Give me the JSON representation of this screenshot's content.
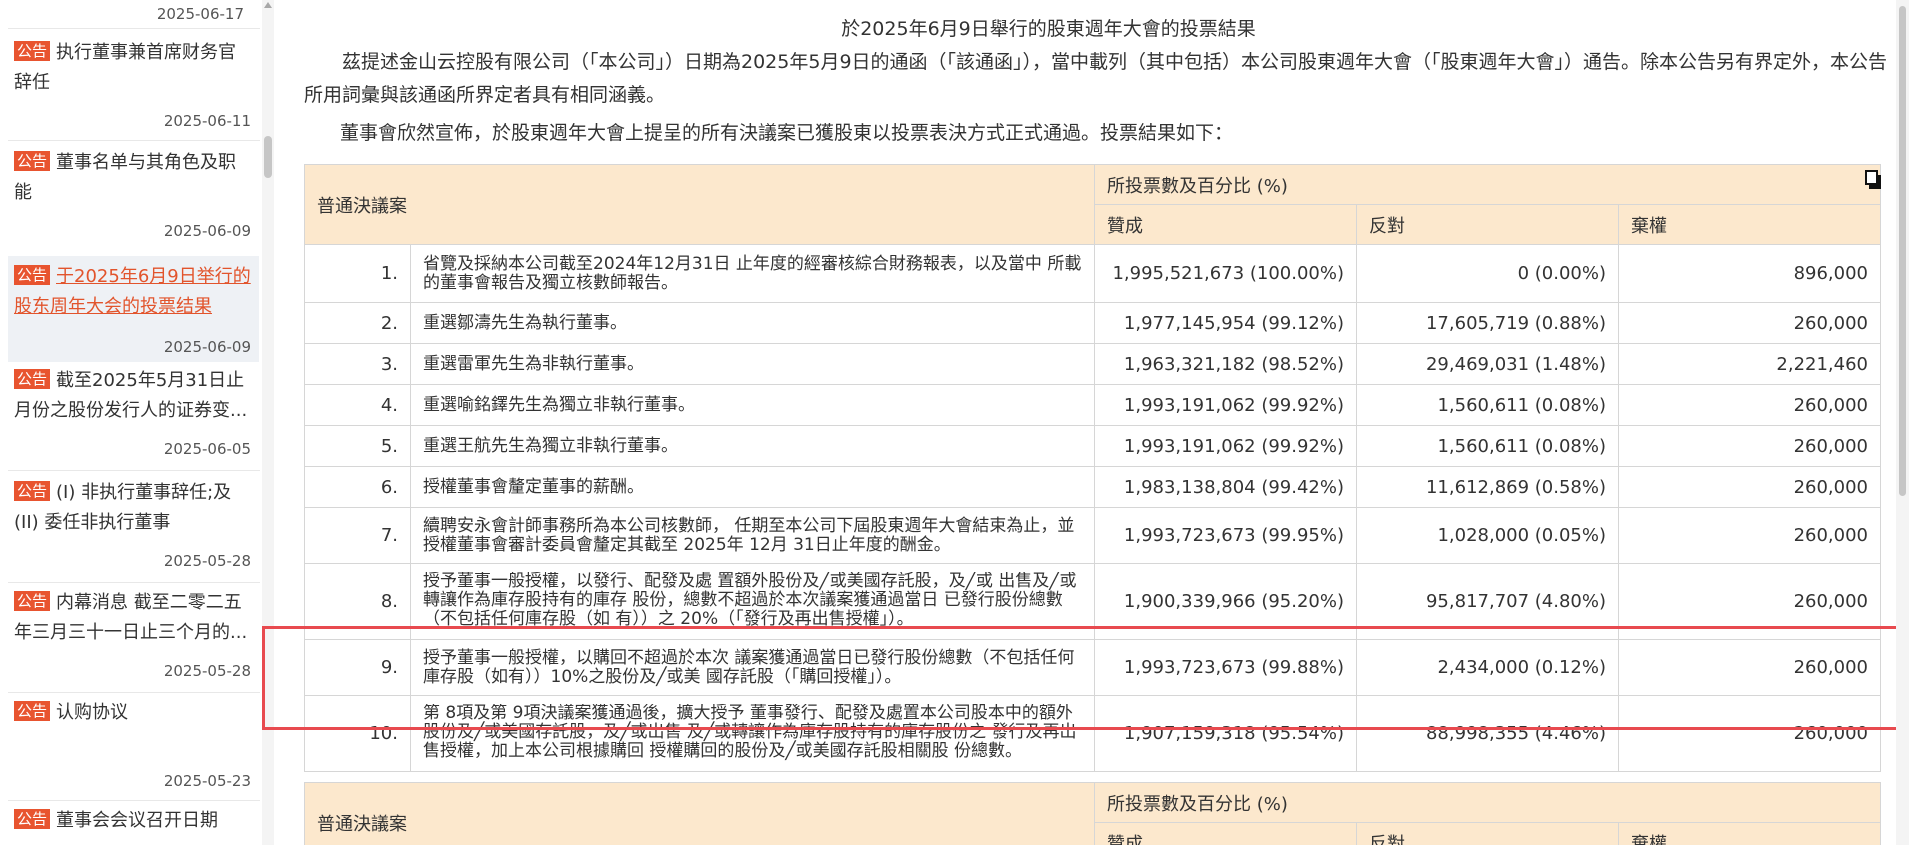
{
  "sidebar": {
    "top_date": "2025-06-17",
    "badge": "公告",
    "items": [
      {
        "title": "执行董事兼首席财务官辞任",
        "date": "2025-06-11"
      },
      {
        "title": "董事名单与其角色及职能",
        "date": "2025-06-09"
      },
      {
        "title": "于2025年6月9日举行的股东周年大会的投票结果",
        "date": "2025-06-09",
        "active": true
      },
      {
        "title": "截至2025年5月31日止月份之股份发行人的证券变...",
        "date": "2025-06-05"
      },
      {
        "title": "(I) 非执行董事辞任;及(II) 委任非执行董事",
        "date": "2025-05-28"
      },
      {
        "title": "内幕消息 截至二零二五年三月三十一日止三个月的...",
        "date": "2025-05-28"
      },
      {
        "title": "认购协议",
        "date": "2025-05-23"
      },
      {
        "title": "董事会会议召开日期",
        "date": ""
      }
    ]
  },
  "main": {
    "subtitle": "於2025年6月9日舉行的股東週年大會的投票結果",
    "para1": "茲提述金山云控股有限公司（「本公司」）日期為2025年5月9日的通函（「該通函」），當中載列（其中包括）本公司股東週年大會（「股東週年大會」）通告。除本公告另有界定外，本公告所用詞彙與該通函所界定者具有相同涵義。",
    "para2": "董事會欣然宣佈，於股東週年大會上提呈的所有決議案已獲股東以投票表決方式正式通過。投票結果如下：",
    "table": {
      "header_resolution": "普通決議案",
      "header_votes": "所投票數及百分比 (%)",
      "col_for": "贊成",
      "col_against": "反對",
      "col_abstain": "棄權",
      "rows": [
        {
          "no": "1.",
          "desc": "省覽及採納本公司截至2024年12月31日 止年度的經審核綜合財務報表，以及當中 所載的董事會報告及獨立核數師報告。",
          "for": "1,995,521,673 (100.00%)",
          "against": "0 (0.00%)",
          "abstain": "896,000"
        },
        {
          "no": "2.",
          "desc": "重選鄒濤先生為執行董事。",
          "for": "1,977,145,954 (99.12%)",
          "against": "17,605,719 (0.88%)",
          "abstain": "260,000"
        },
        {
          "no": "3.",
          "desc": "重選雷軍先生為非執行董事。",
          "for": "1,963,321,182 (98.52%)",
          "against": "29,469,031 (1.48%)",
          "abstain": "2,221,460"
        },
        {
          "no": "4.",
          "desc": "重選喻銘鐸先生為獨立非執行董事。",
          "for": "1,993,191,062 (99.92%)",
          "against": "1,560,611 (0.08%)",
          "abstain": "260,000"
        },
        {
          "no": "5.",
          "desc": "重選王航先生為獨立非執行董事。",
          "for": "1,993,191,062 (99.92%)",
          "against": "1,560,611 (0.08%)",
          "abstain": "260,000"
        },
        {
          "no": "6.",
          "desc": "授權董事會釐定董事的薪酬。",
          "for": "1,983,138,804 (99.42%)",
          "against": "11,612,869 (0.58%)",
          "abstain": "260,000"
        },
        {
          "no": "7.",
          "desc": "續聘安永會計師事務所為本公司核數師， 任期至本公司下屆股東週年大會結束為止，並授權董事會審計委員會釐定其截至 2025年 12月 31日止年度的酬金。",
          "for": "1,993,723,673 (99.95%)",
          "against": "1,028,000 (0.05%)",
          "abstain": "260,000"
        },
        {
          "no": "8.",
          "desc": "授予董事一般授權，以發行、配發及處 置額外股份及╱或美國存託股，及╱或 出售及╱或轉讓作為庫存股持有的庫存 股份，總數不超過於本次議案獲通過當日 已發行股份總數（不包括任何庫存股（如 有））之 20%（「發行及再出售授權」）。",
          "for": "1,900,339,966 (95.20%)",
          "against": "95,817,707 (4.80%)",
          "abstain": "260,000"
        },
        {
          "no": "9.",
          "desc": "授予董事一般授權，以購回不超過於本次 議案獲通過當日已發行股份總數（不包括任何庫存股（如有））10%之股份及╱或美 國存託股（「購回授權」）。",
          "for": "1,993,723,673 (99.88%)",
          "against": "2,434,000 (0.12%)",
          "abstain": "260,000"
        },
        {
          "no": "10.",
          "desc": "第 8項及第 9項決議案獲通過後，擴大授予 董事發行、配發及處置本公司股本中的額外股份及╱或美國存託股，及╱或出售 及╱或轉讓作為庫存股持有的庫存股份之 發行及再出售授權，加上本公司根據購回 授權購回的股份及╱或美國存託股相關股 份總數。",
          "for": "1,907,159,318 (95.54%)",
          "against": "88,998,355 (4.46%)",
          "abstain": "260,000"
        }
      ]
    },
    "table2": {
      "header_resolution": "普通決議案",
      "header_votes": "所投票數及百分比 (%)",
      "col_for": "贊成",
      "col_against": "反對",
      "col_abstain": "棄權"
    }
  }
}
